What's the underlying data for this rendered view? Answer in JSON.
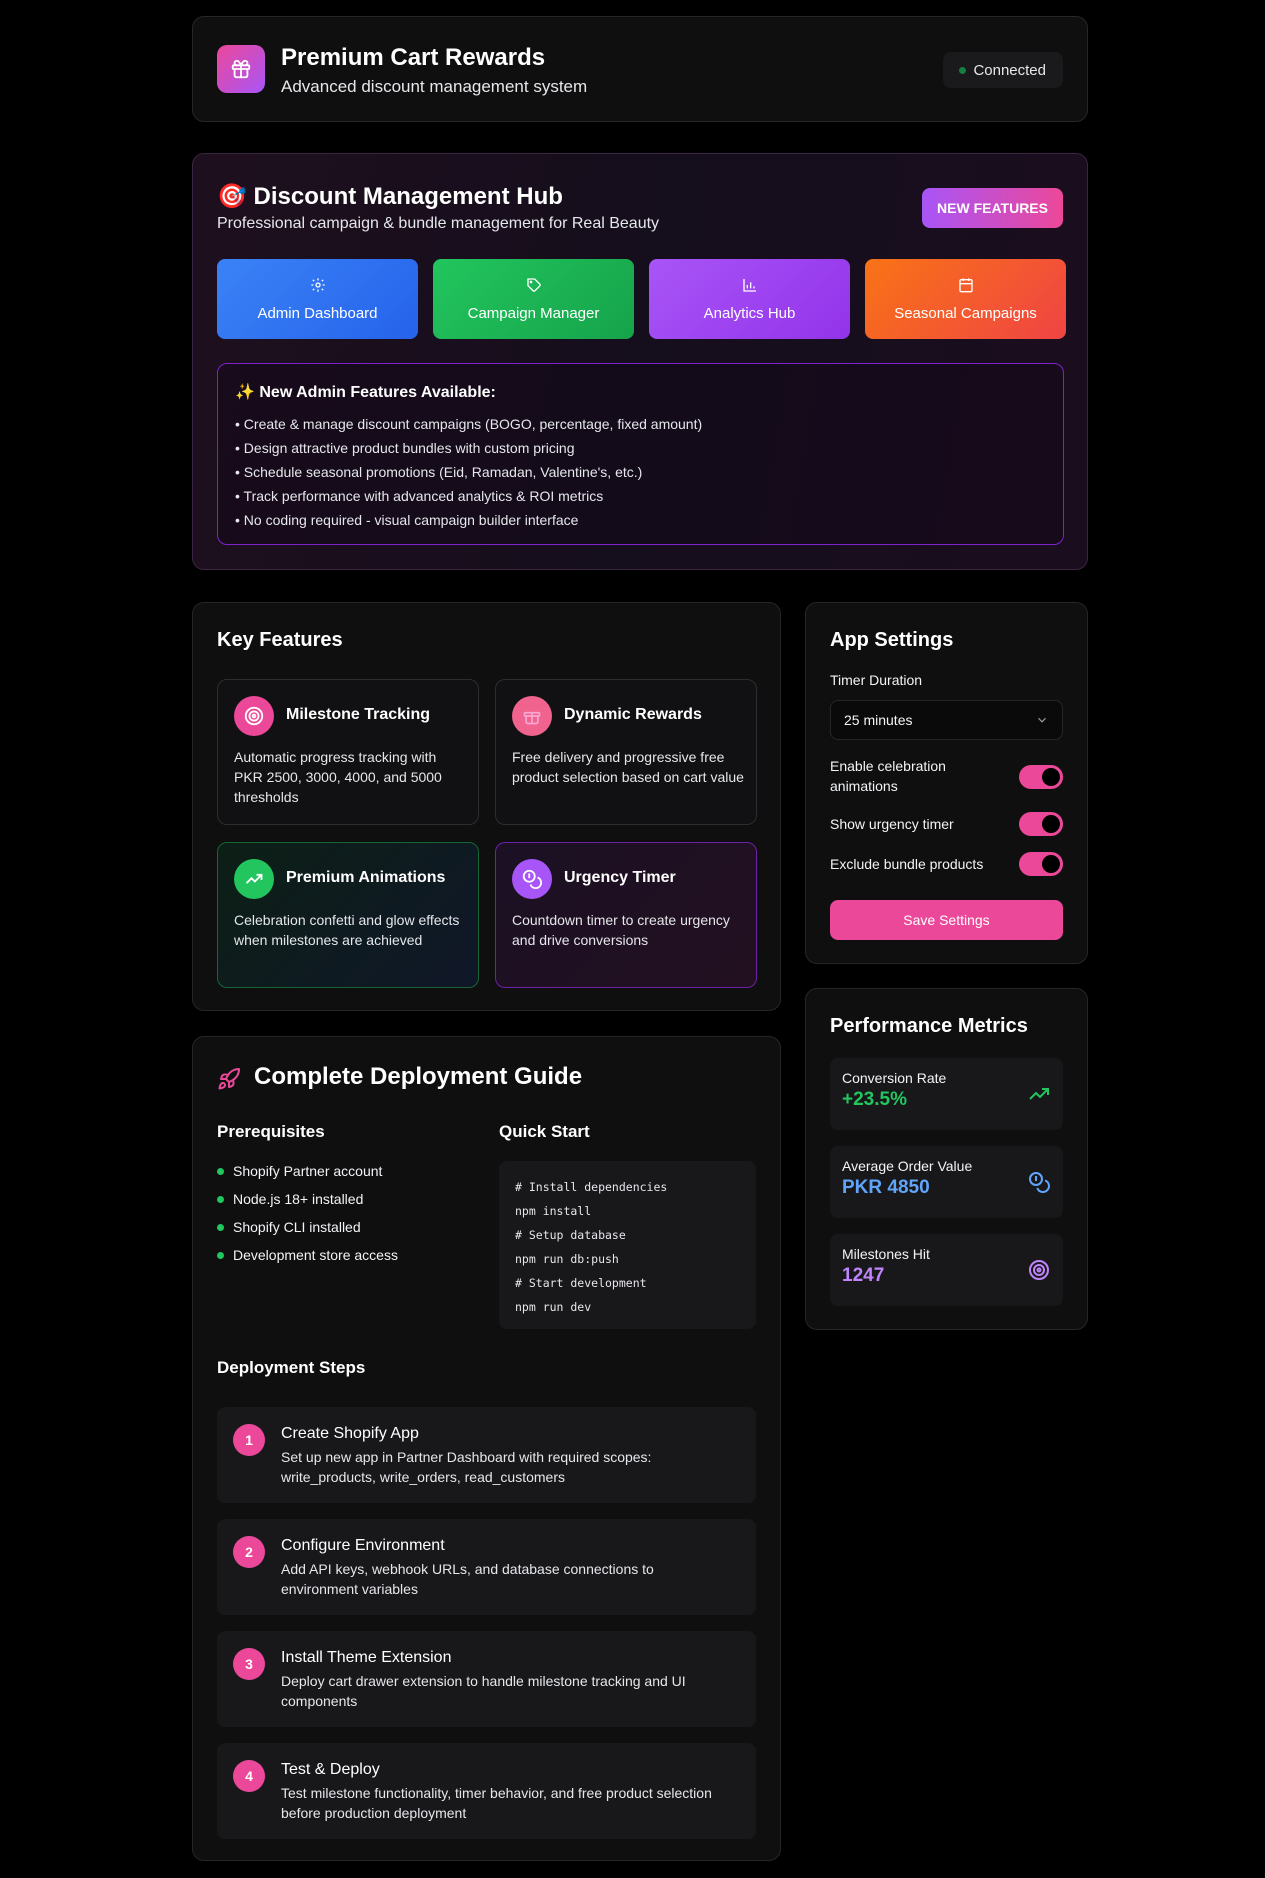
{
  "header": {
    "title": "Premium Cart Rewards",
    "subtitle": "Advanced discount management system",
    "status": "Connected"
  },
  "hub": {
    "title": "🎯 Discount Management Hub",
    "subtitle": "Professional campaign & bundle management for Real Beauty",
    "badge": "NEW FEATURES",
    "tiles": [
      {
        "label": "Admin Dashboard",
        "icon": "gear-icon"
      },
      {
        "label": "Campaign Manager",
        "icon": "tag-icon"
      },
      {
        "label": "Analytics Hub",
        "icon": "bar-chart-icon"
      },
      {
        "label": "Seasonal Campaigns",
        "icon": "calendar-icon"
      }
    ],
    "features_title": "✨ New Admin Features Available:",
    "features": [
      "• Create & manage discount campaigns (BOGO, percentage, fixed amount)",
      "• Design attractive product bundles with custom pricing",
      "• Schedule seasonal promotions (Eid, Ramadan, Valentine's, etc.)",
      "• Track performance with advanced analytics & ROI metrics",
      "• No coding required - visual campaign builder interface"
    ]
  },
  "key_features": {
    "title": "Key Features",
    "cards": [
      {
        "title": "Milestone Tracking",
        "desc": "Automatic progress tracking with PKR 2500, 3000, 4000, and 5000 thresholds",
        "icon": "target-icon"
      },
      {
        "title": "Dynamic Rewards",
        "desc": "Free delivery and progressive free product selection based on cart value",
        "icon": "gift-icon"
      },
      {
        "title": "Premium Animations",
        "desc": "Celebration confetti and glow effects when milestones are achieved",
        "icon": "trending-up-icon"
      },
      {
        "title": "Urgency Timer",
        "desc": "Countdown timer to create urgency and drive conversions",
        "icon": "coins-icon"
      }
    ]
  },
  "settings": {
    "title": "App Settings",
    "timer_label": "Timer Duration",
    "timer_value": "25 minutes",
    "toggles": [
      {
        "label": "Enable celebration animations",
        "on": true
      },
      {
        "label": "Show urgency timer",
        "on": true
      },
      {
        "label": "Exclude bundle products",
        "on": true
      }
    ],
    "save_label": "Save Settings"
  },
  "performance": {
    "title": "Performance Metrics",
    "metrics": [
      {
        "label": "Conversion Rate",
        "value": "+23.5%",
        "color": "#22c55e",
        "icon": "trending-up-icon"
      },
      {
        "label": "Average Order Value",
        "value": "PKR 4850",
        "color": "#60a5fa",
        "icon": "coins-icon"
      },
      {
        "label": "Milestones Hit",
        "value": "1247",
        "color": "#c084fc",
        "icon": "target-icon"
      }
    ]
  },
  "deploy": {
    "title": "Complete Deployment Guide",
    "prereq_title": "Prerequisites",
    "prereqs": [
      "Shopify Partner account",
      "Node.js 18+ installed",
      "Shopify CLI installed",
      "Development store access"
    ],
    "quickstart_title": "Quick Start",
    "code": [
      "# Install dependencies",
      "npm install",
      "# Setup database",
      "npm run db:push",
      "# Start development",
      "npm run dev"
    ],
    "steps_title": "Deployment Steps",
    "steps": [
      {
        "num": "1",
        "title": "Create Shopify App",
        "desc": "Set up new app in Partner Dashboard with required scopes: write_products, write_orders, read_customers"
      },
      {
        "num": "2",
        "title": "Configure Environment",
        "desc": "Add API keys, webhook URLs, and database connections to environment variables"
      },
      {
        "num": "3",
        "title": "Install Theme Extension",
        "desc": "Deploy cart drawer extension to handle milestone tracking and UI components"
      },
      {
        "num": "4",
        "title": "Test & Deploy",
        "desc": "Test milestone functionality, timer behavior, and free product selection before production deployment"
      }
    ]
  }
}
